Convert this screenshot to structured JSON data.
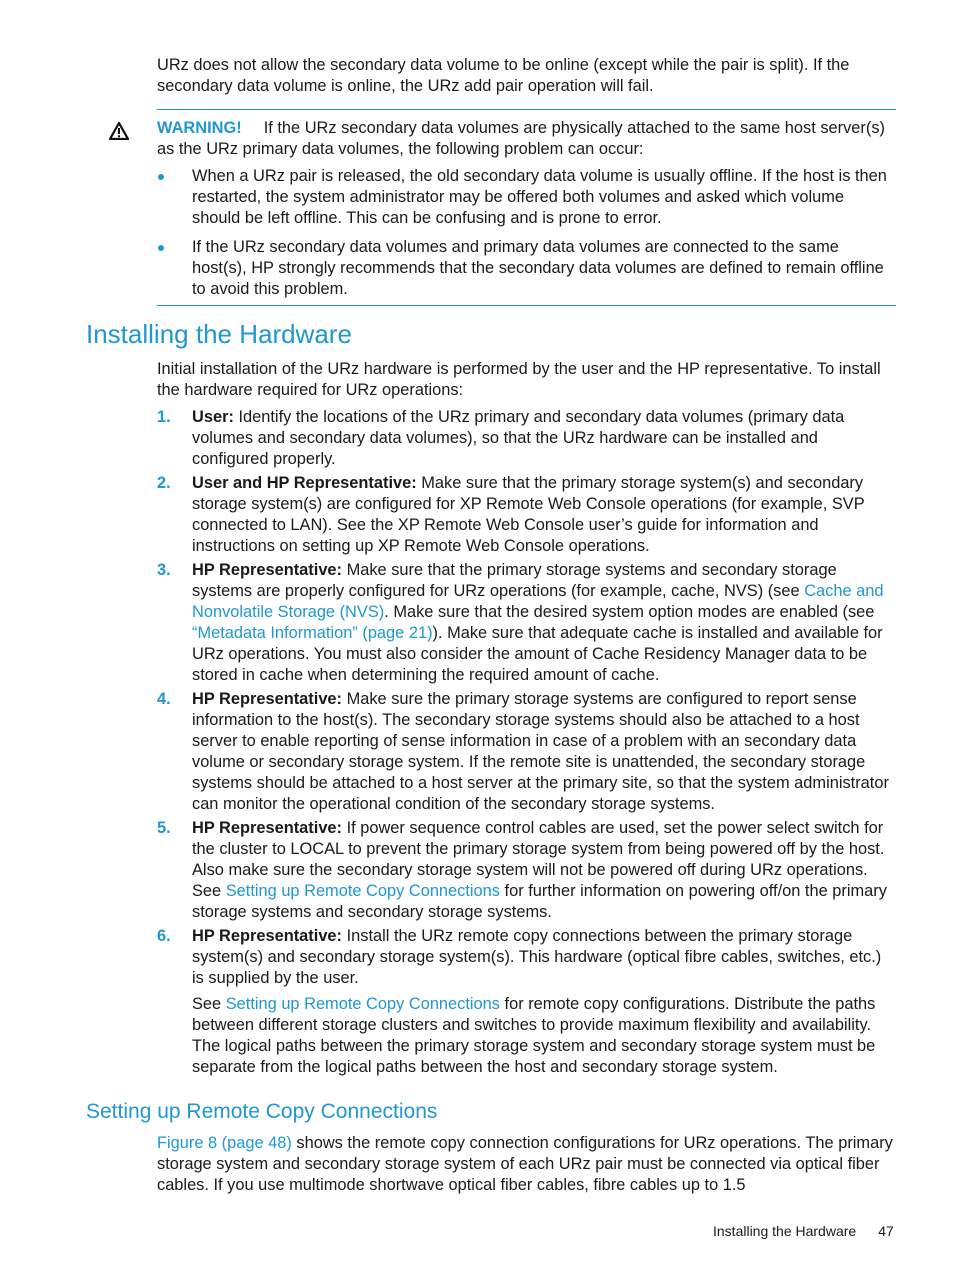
{
  "intro": {
    "text": "URz does not allow the secondary data volume to be online (except while the pair is split). If the secondary data volume is online, the URz add pair operation will fail."
  },
  "warning": {
    "icon": "warning-triangle-icon",
    "label": "WARNING!",
    "text": "If the URz secondary data volumes are physically attached to the same host server(s) as the URz primary data volumes, the following problem can occur:",
    "bullets": [
      "When a URz pair is released, the old secondary data volume is usually offline. If the host is then restarted, the system administrator may be offered both volumes and asked which volume should be left offline. This can be confusing and is prone to error.",
      "If the URz secondary data volumes and primary data volumes are connected to the same host(s), HP strongly recommends that the secondary data volumes are defined to remain offline to avoid this problem."
    ]
  },
  "section": {
    "title": "Installing the Hardware",
    "intro": "Initial installation of the URz hardware is performed by the user and the HP representative. To install the hardware required for URz operations:",
    "steps": [
      {
        "num": "1.",
        "lead": "User:",
        "text": "Identify the locations of the URz primary and secondary data volumes (primary data volumes and secondary data volumes), so that the URz hardware can be installed and configured properly."
      },
      {
        "num": "2.",
        "lead": "User and HP Representative:",
        "text": "Make sure that the primary storage system(s) and secondary storage system(s) are configured for XP Remote Web Console operations (for example, SVP connected to LAN). See the XP Remote Web Console user’s guide for information and instructions on setting up XP Remote Web Console operations."
      },
      {
        "num": "3.",
        "lead": "HP Representative:",
        "text_a": "Make sure that the primary storage systems and secondary storage systems are properly configured for URz operations (for example, cache, NVS) (see",
        "link_a": "Cache and Nonvolatile Storage (NVS)",
        "text_b": ". Make sure that the desired system option modes are enabled (see",
        "link_b": "“Metadata Information” (page 21)",
        "text_c": "). Make sure that adequate cache is installed and available for URz operations. You must also consider the amount of Cache Residency Manager data to be stored in cache when determining the required amount of cache."
      },
      {
        "num": "4.",
        "lead": "HP Representative:",
        "text": "Make sure the primary storage systems are configured to report sense information to the host(s). The secondary storage systems should also be attached to a host server to enable reporting of sense information in case of a problem with an secondary data volume or secondary storage system. If the remote site is unattended, the secondary storage systems should be attached to a host server at the primary site, so that the system administrator can monitor the operational condition of the secondary storage systems."
      },
      {
        "num": "5.",
        "lead": "HP Representative:",
        "text_a": "If power sequence control cables are used, set the power select switch for the cluster to LOCAL to prevent the primary storage system from being powered off by the host. Also make sure the secondary storage system will not be powered off during URz operations. See",
        "link_a": "Setting up Remote Copy Connections",
        "text_b": "for further information on powering off/on the primary storage systems and secondary storage systems."
      },
      {
        "num": "6.",
        "lead": "HP Representative:",
        "text": "Install the URz remote copy connections between the primary storage system(s) and secondary storage system(s). This hardware (optical fibre cables, switches, etc.) is supplied by the user.",
        "sub_a": "See",
        "sub_link": "Setting up Remote Copy Connections",
        "sub_b": "for remote copy configurations. Distribute the paths between different storage clusters and switches to provide maximum flexibility and availability. The logical paths between the primary storage system and secondary storage system must be separate from the logical paths between the host and secondary storage system."
      }
    ]
  },
  "subsection": {
    "title": "Setting up Remote Copy Connections",
    "link": "Figure 8 (page 48)",
    "text": "shows the remote copy connection configurations for URz operations. The primary storage system and secondary storage system of each URz pair must be connected via optical fiber cables. If you use multimode shortwave optical fiber cables, fibre cables up to 1.5"
  },
  "footer": {
    "section": "Installing the Hardware",
    "page": "47"
  }
}
